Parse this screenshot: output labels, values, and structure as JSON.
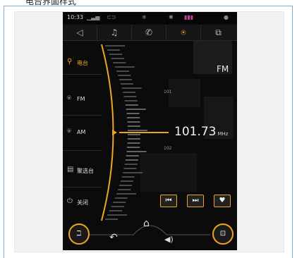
{
  "document": {
    "heading": "电台界面样式"
  },
  "status_bar": {
    "time": "10:33"
  },
  "tabs": [
    {
      "icon": "navigation-icon",
      "glyph": "◁",
      "active": false
    },
    {
      "icon": "music-icon",
      "glyph": "♫",
      "active": false
    },
    {
      "icon": "phone-icon",
      "glyph": "✆",
      "active": false
    },
    {
      "icon": "radio-icon",
      "glyph": "⍟",
      "active": true
    },
    {
      "icon": "apps-icon",
      "glyph": "⧉",
      "active": false
    }
  ],
  "menu": {
    "search_label": "电台",
    "fm_label": "FM",
    "am_label": "AM",
    "favorites_label": "聚选台",
    "off_label": "关闭"
  },
  "tuner": {
    "band": "FM",
    "frequency": "101.73",
    "unit": "MHz",
    "tick_upper": "101",
    "tick_lower": "102"
  },
  "colors": {
    "accent": "#f0a520",
    "background": "#0b0b0b"
  }
}
